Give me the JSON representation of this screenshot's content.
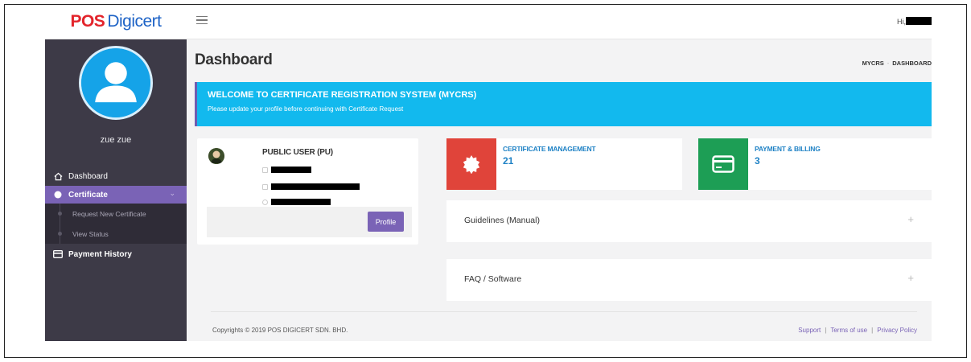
{
  "brand": {
    "part1": "POS",
    "part2": "Digicert"
  },
  "topbar": {
    "greeting": "Hi,"
  },
  "sidebar": {
    "username": "zue zue",
    "items": [
      {
        "label": "Dashboard",
        "icon": "home-icon"
      },
      {
        "label": "Certificate",
        "icon": "circle-icon",
        "active": true
      },
      {
        "label": "Payment History",
        "icon": "card-icon"
      }
    ],
    "submenu": [
      {
        "label": "Request New Certificate"
      },
      {
        "label": "View Status"
      }
    ]
  },
  "page": {
    "title": "Dashboard",
    "breadcrumb": [
      "MYCRS",
      "DASHBOARD"
    ]
  },
  "banner": {
    "title": "WELCOME TO CERTIFICATE REGISTRATION SYSTEM (MYCRS)",
    "subtitle": "Please update your profile before continuing with Certificate Request"
  },
  "profile_card": {
    "role": "PUBLIC USER (PU)",
    "button_label": "Profile"
  },
  "stats": [
    {
      "label": "CERTIFICATE MANAGEMENT",
      "value": "21",
      "color": "#e0443a",
      "icon": "seal-icon"
    },
    {
      "label": "PAYMENT & BILLING",
      "value": "3",
      "color": "#1d9e55",
      "icon": "credit-card-icon"
    }
  ],
  "accordions": [
    {
      "label": "Guidelines (Manual)",
      "toggle": "+"
    },
    {
      "label": "FAQ / Software",
      "toggle": "+"
    }
  ],
  "footer": {
    "copyright": "Copyrights © 2019 POS DIGICERT SDN. BHD.",
    "links": [
      "Support",
      "Terms of use",
      "Privacy Policy"
    ],
    "separator": "|"
  },
  "colors": {
    "accent": "#7a63b6",
    "banner": "#12b9ee",
    "sidebar": "#3d3a47"
  }
}
